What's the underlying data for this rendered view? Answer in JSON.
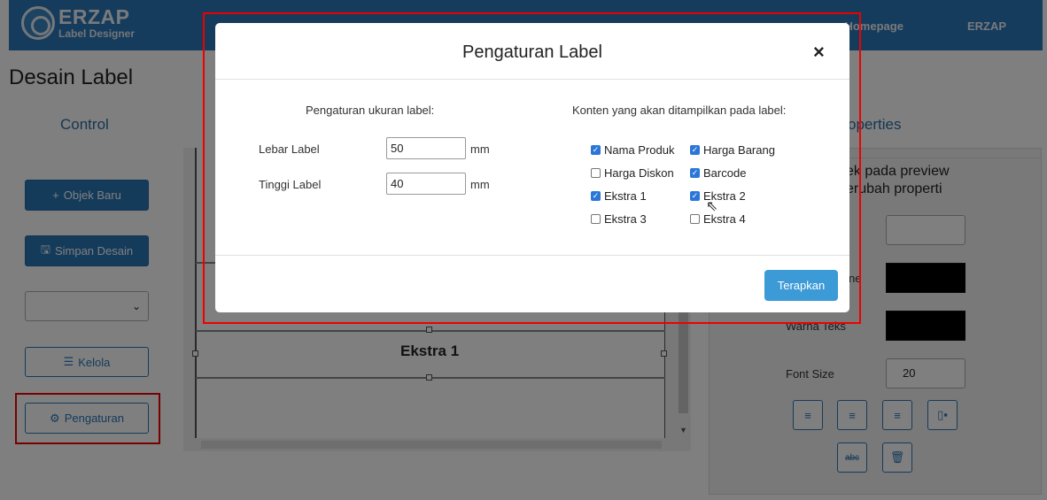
{
  "navbar": {
    "brand_name": "ERZAP",
    "brand_sub": "Label Designer",
    "homepage_label": "Homepage",
    "user_label": "ERZAP"
  },
  "page": {
    "title": "Desain Label"
  },
  "control": {
    "title": "Control",
    "new_object_label": "Objek Baru",
    "save_label": "Simpan Desain",
    "select_value": "",
    "manage_label": "Kelola",
    "settings_label": "Pengaturan"
  },
  "canvas": {
    "element_label": "Ekstra 1"
  },
  "properties": {
    "title": "Properties",
    "hint_line1": "ek pada preview",
    "hint_line2": "erubah properti",
    "line_label_fragment": "ne",
    "text_color_label": "Warna Teks",
    "font_size_label": "Font Size",
    "font_size_value": "20",
    "colors": {
      "line": "#000000",
      "text": "#000000"
    },
    "tools": [
      "align-left-icon",
      "align-center-icon",
      "align-right-icon",
      "align-justify-icon",
      "strikethrough-icon",
      "trash-icon"
    ]
  },
  "modal": {
    "title": "Pengaturan Label",
    "size_section": "Pengaturan ukuran label:",
    "width_label": "Lebar Label",
    "width_value": "50",
    "height_label": "Tinggi Label",
    "height_value": "40",
    "unit": "mm",
    "content_section": "Konten yang akan ditampilkan pada label:",
    "options": [
      {
        "label": "Nama Produk",
        "checked": true
      },
      {
        "label": "Harga Barang",
        "checked": true
      },
      {
        "label": "Harga Diskon",
        "checked": false
      },
      {
        "label": "Barcode",
        "checked": true
      },
      {
        "label": "Ekstra 1",
        "checked": true
      },
      {
        "label": "Ekstra 2",
        "checked": true
      },
      {
        "label": "Ekstra 3",
        "checked": false
      },
      {
        "label": "Ekstra 4",
        "checked": false
      }
    ],
    "apply_label": "Terapkan"
  },
  "colors": {
    "primary": "#2b78b8",
    "apply": "#3c9ad6",
    "highlight": "#ee0000"
  }
}
